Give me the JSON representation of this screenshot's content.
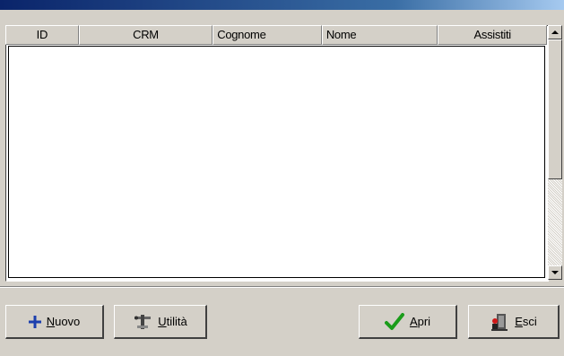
{
  "table": {
    "columns": [
      "ID",
      "CRM",
      "Cognome",
      "Nome",
      "Assistiti"
    ],
    "rows": []
  },
  "buttons": {
    "nuovo": {
      "label": "Nuovo",
      "icon": "plus-icon"
    },
    "utilita": {
      "label": "Utilità",
      "icon": "tools-icon"
    },
    "apri": {
      "label": "Apri",
      "icon": "checkmark-icon"
    },
    "esci": {
      "label": "Esci",
      "icon": "exit-door-icon"
    }
  },
  "colors": {
    "titlebar": "#0a246a",
    "plus": "#1c3fae",
    "check": "#1a9c1a"
  }
}
